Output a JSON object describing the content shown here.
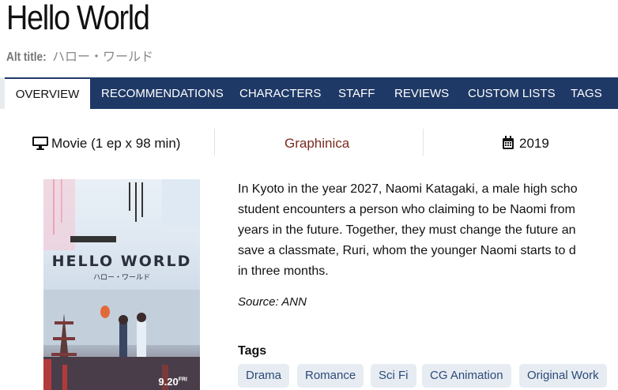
{
  "header": {
    "title": "Hello World",
    "alt_title_label": "Alt title:",
    "alt_title_value": "ハロー・ワールド"
  },
  "nav": {
    "tabs": [
      {
        "label": "OVERVIEW",
        "active": true
      },
      {
        "label": "RECOMMENDATIONS"
      },
      {
        "label": "CHARACTERS"
      },
      {
        "label": "STAFF"
      },
      {
        "label": "REVIEWS"
      },
      {
        "label": "CUSTOM LISTS"
      },
      {
        "label": "TAGS"
      }
    ]
  },
  "info": {
    "format": "Movie (1 ep x 98 min)",
    "studio": "Graphinica",
    "year": "2019"
  },
  "poster": {
    "title_text": "HELLO WORLD",
    "subtitle_text": "ハロー・ワールド",
    "date_text": "9.20",
    "date_suffix": "FRI"
  },
  "synopsis": {
    "lines": [
      "In Kyoto in the year 2027, Naomi Katagaki, a male high scho",
      "student encounters a person who claiming to be Naomi from",
      "years in the future. Together, they must change the future an",
      "save a classmate, Ruri, whom the younger Naomi starts to d",
      "in three months."
    ],
    "source": "Source: ANN"
  },
  "tags": {
    "label": "Tags",
    "items": [
      "Drama",
      "Romance",
      "Sci Fi",
      "CG Animation",
      "Original Work"
    ]
  },
  "colors": {
    "nav_bg": "#1f3966",
    "studio_link": "#7b2a1e",
    "tag_bg": "#e7ecf2",
    "tag_text": "#2c4a78"
  }
}
